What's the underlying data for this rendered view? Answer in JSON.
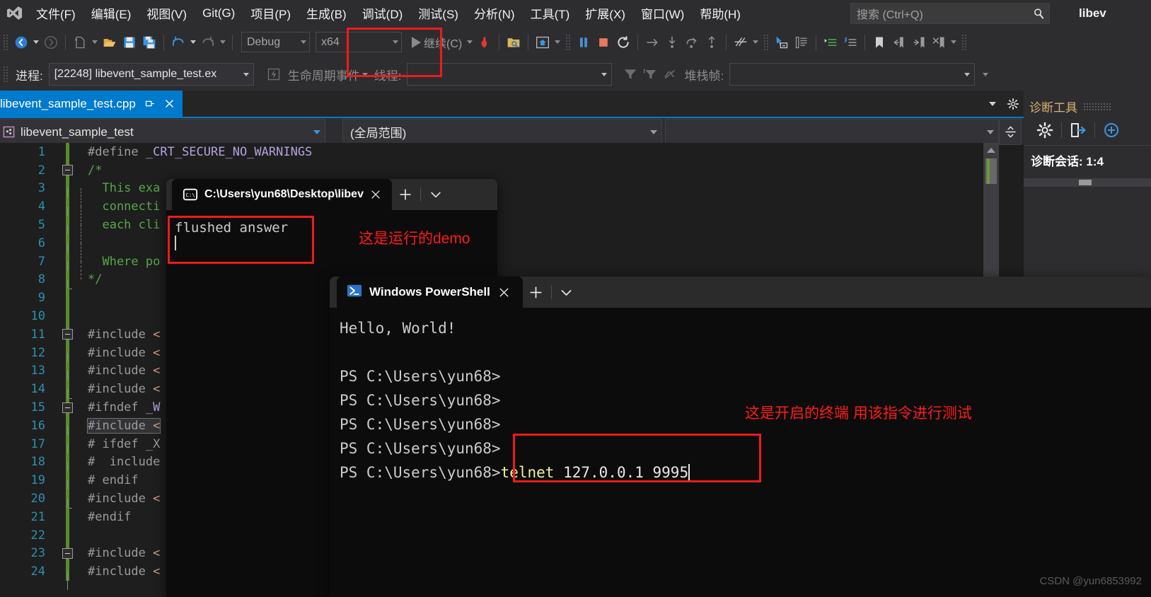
{
  "menubar": {
    "items": [
      {
        "label": "文件(F)"
      },
      {
        "label": "编辑(E)"
      },
      {
        "label": "视图(V)"
      },
      {
        "label": "Git(G)"
      },
      {
        "label": "项目(P)"
      },
      {
        "label": "生成(B)"
      },
      {
        "label": "调试(D)"
      },
      {
        "label": "测试(S)"
      },
      {
        "label": "分析(N)"
      },
      {
        "label": "工具(T)"
      },
      {
        "label": "扩展(X)"
      },
      {
        "label": "窗口(W)"
      },
      {
        "label": "帮助(H)"
      }
    ],
    "search_placeholder": "搜索 (Ctrl+Q)",
    "window_title": "libev"
  },
  "toolbar": {
    "configuration": "Debug",
    "platform": "x64",
    "continue_label": "继续(C)"
  },
  "debug_bar": {
    "process_label": "进程:",
    "process_value": "[22248] libevent_sample_test.ex",
    "lifecycle_label": "生命周期事件",
    "thread_label": "线程:",
    "thread_value": "",
    "stackframe_label": "堆栈帧:",
    "stackframe_value": ""
  },
  "document_tab": {
    "title": "libevent_sample_test.cpp"
  },
  "navbar": {
    "project": "libevent_sample_test",
    "scope": "(全局范围)",
    "member": ""
  },
  "editor": {
    "lines": [
      {
        "num": "1",
        "fold": "none",
        "guide": "none",
        "text": "#define _CRT_SECURE_NO_WARNINGS",
        "kind": "define"
      },
      {
        "num": "2",
        "fold": "collapse",
        "guide": "none",
        "text": "/*",
        "kind": "comment"
      },
      {
        "num": "3",
        "fold": "none",
        "guide": "full-dash",
        "text": "  This exa",
        "kind": "comment"
      },
      {
        "num": "4",
        "fold": "none",
        "guide": "full-dash",
        "text": "  connecti",
        "kind": "comment"
      },
      {
        "num": "5",
        "fold": "none",
        "guide": "full-dash",
        "text": "  each cli",
        "kind": "comment"
      },
      {
        "num": "6",
        "fold": "none",
        "guide": "full-dash",
        "text": "",
        "kind": "comment"
      },
      {
        "num": "7",
        "fold": "none",
        "guide": "full-dash",
        "text": "  Where po",
        "kind": "comment"
      },
      {
        "num": "8",
        "fold": "none",
        "guide": "elbow",
        "text": "*/",
        "kind": "comment"
      },
      {
        "num": "9",
        "fold": "none",
        "guide": "none",
        "text": "",
        "kind": "plain"
      },
      {
        "num": "10",
        "fold": "none",
        "guide": "none",
        "text": "",
        "kind": "plain"
      },
      {
        "num": "11",
        "fold": "collapse",
        "guide": "none",
        "text": "#include <",
        "kind": "include"
      },
      {
        "num": "12",
        "fold": "none",
        "guide": "full",
        "text": "#include <",
        "kind": "include"
      },
      {
        "num": "13",
        "fold": "none",
        "guide": "full",
        "text": "#include <",
        "kind": "include"
      },
      {
        "num": "14",
        "fold": "none",
        "guide": "elbow",
        "text": "#include <",
        "kind": "include"
      },
      {
        "num": "15",
        "fold": "collapse",
        "guide": "none",
        "text": "#ifndef _W",
        "kind": "ifndef"
      },
      {
        "num": "16",
        "fold": "none",
        "guide": "full",
        "text": "#include <",
        "kind": "include-highlight"
      },
      {
        "num": "17",
        "fold": "none",
        "guide": "full",
        "text": "# ifdef _X",
        "kind": "include"
      },
      {
        "num": "18",
        "fold": "none",
        "guide": "full",
        "text": "#  include",
        "kind": "include"
      },
      {
        "num": "19",
        "fold": "none",
        "guide": "full",
        "text": "# endif",
        "kind": "include"
      },
      {
        "num": "20",
        "fold": "none",
        "guide": "elbow",
        "text": "#include <",
        "kind": "include"
      },
      {
        "num": "21",
        "fold": "none",
        "guide": "none",
        "text": "#endif",
        "kind": "include"
      },
      {
        "num": "22",
        "fold": "none",
        "guide": "none",
        "text": "",
        "kind": "plain"
      },
      {
        "num": "23",
        "fold": "collapse",
        "guide": "none",
        "text": "#include <",
        "kind": "include"
      },
      {
        "num": "24",
        "fold": "none",
        "guide": "full",
        "text": "#include <",
        "kind": "include"
      }
    ]
  },
  "diagnostics": {
    "title": "诊断工具",
    "session": "诊断会话: 1:4"
  },
  "cmd_terminal": {
    "tab_title": "C:\\Users\\yun68\\Desktop\\libev",
    "output": "flushed answer"
  },
  "powershell": {
    "tab_title": "Windows PowerShell",
    "output_line": "Hello, World!",
    "prompts": [
      "PS C:\\Users\\yun68>",
      "PS C:\\Users\\yun68>",
      "PS C:\\Users\\yun68>",
      "PS C:\\Users\\yun68>",
      "PS C:\\Users\\yun68>"
    ],
    "command_keyword": "telnet",
    "command_args": " 127.0.0.1 9995"
  },
  "annotations": {
    "demo_note": "这是运行的demo",
    "terminal_note": "这是开启的终端 用该指令进行测试"
  },
  "watermark": "CSDN @yun6853992",
  "colors": {
    "accent": "#007acc",
    "annotation_red": "#ff1a1a",
    "comment_green": "#57a64a",
    "linenumber_blue": "#2b91af",
    "macro_purple": "#b4a0e0",
    "diag_title": "#d7b56d"
  }
}
